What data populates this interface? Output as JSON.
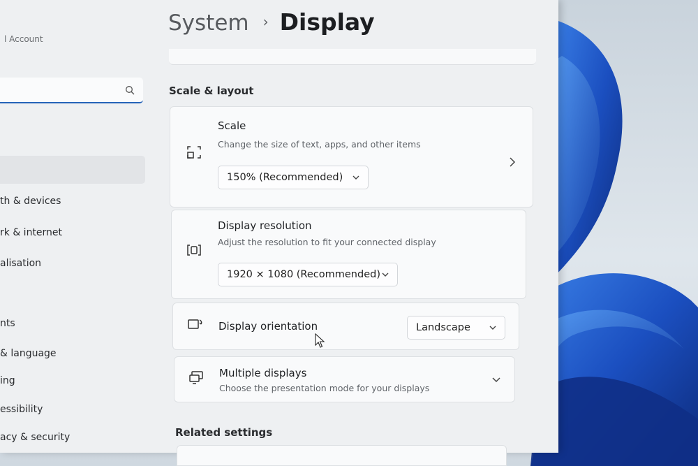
{
  "sidebar": {
    "account_label": "l Account",
    "search": {
      "placeholder": ""
    },
    "items": [
      {
        "label": ""
      },
      {
        "label": "th & devices"
      },
      {
        "label": "rk & internet"
      },
      {
        "label": "alisation"
      },
      {
        "label": "nts"
      },
      {
        "label": "& language"
      },
      {
        "label": "ing"
      },
      {
        "label": "essibility"
      },
      {
        "label": "acy & security"
      }
    ]
  },
  "breadcrumb": {
    "parent": "System",
    "separator": "›",
    "current": "Display"
  },
  "scale_layout": {
    "heading": "Scale & layout",
    "scale": {
      "title": "Scale",
      "subtitle": "Change the size of text, apps, and other items",
      "value": "150% (Recommended)",
      "icon": "scale-icon"
    },
    "resolution": {
      "title": "Display resolution",
      "subtitle": "Adjust the resolution to fit your connected display",
      "value": "1920 × 1080 (Recommended)",
      "icon": "resolution-icon"
    },
    "orientation": {
      "title": "Display orientation",
      "value": "Landscape",
      "icon": "orientation-icon"
    },
    "multiple": {
      "title": "Multiple displays",
      "subtitle": "Choose the presentation mode for your displays",
      "icon": "multiple-displays-icon"
    }
  },
  "related": {
    "heading": "Related settings"
  },
  "colors": {
    "accent": "#2563b8",
    "window_bg": "#eef0f2",
    "card_bg": "#f9fafb"
  }
}
